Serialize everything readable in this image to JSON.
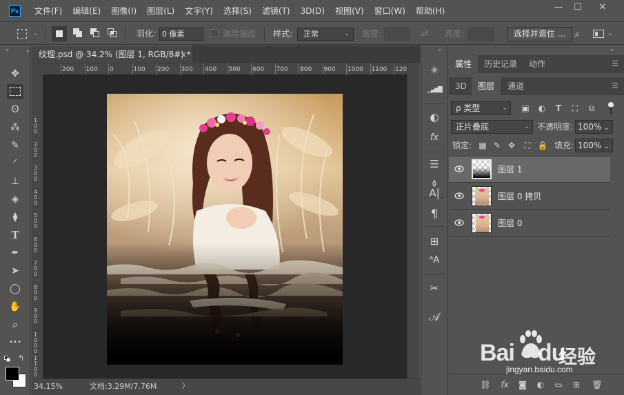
{
  "app": {
    "logo": "Ps"
  },
  "menu": [
    "文件(F)",
    "编辑(E)",
    "图像(I)",
    "图层(L)",
    "文字(Y)",
    "选择(S)",
    "滤镜(T)",
    "3D(D)",
    "视图(V)",
    "窗口(W)",
    "帮助(H)"
  ],
  "window_controls": {
    "minimize": "—",
    "restore": "☐",
    "close": "✕"
  },
  "options": {
    "feather_label": "羽化:",
    "feather_value": "0 像素",
    "antialias_label": "消除锯齿",
    "style_label": "样式:",
    "style_value": "正常",
    "width_label": "宽度:",
    "height_label": "高度:",
    "select_mask_button": "选择并遮住 ..."
  },
  "document": {
    "tab_title": "纹理.psd @ 34.2% (图层 1, RGB/8#) *",
    "close": "×",
    "ruler_h": [
      "200",
      "100",
      "0",
      "100",
      "200",
      "300",
      "400",
      "500",
      "600",
      "700",
      "800",
      "900",
      "1000",
      "1100",
      "1200"
    ],
    "ruler_v": [
      "1\n0\n0",
      "2\n0\n0",
      "3\n0\n0",
      "4\n0\n0",
      "5\n0\n0",
      "6\n0\n0",
      "7\n0\n0",
      "8\n0\n0",
      "9\n0\n0",
      "1\n0\n0\n0",
      "1\n1\n0\n0",
      "1\n2\n0\n0"
    ],
    "zoom": "34.15%",
    "doc_size": "文档:3.29M/7.76M",
    "status_arrow": "〉"
  },
  "tools": {
    "icons": [
      "move-icon",
      "marquee-icon",
      "lasso-icon",
      "magic-wand-icon",
      "eyedropper-icon",
      "brush-icon",
      "stamp-icon",
      "eraser-icon",
      "paint-bucket-icon",
      "type-icon",
      "pen-icon",
      "path-select-icon",
      "ellipse-icon",
      "hand-icon",
      "zoom-icon",
      "more-icon"
    ],
    "glyphs": [
      "✥",
      "⬚",
      "ʘ",
      "⁂",
      "✎",
      "ᐟ",
      "⊥",
      "◈",
      "⧫",
      "T",
      "✒",
      "➤",
      "◯",
      "✋",
      "⌕",
      "•••"
    ]
  },
  "strip": {
    "glyphs": [
      "✳",
      "▁▃▅▇",
      "◐",
      "fx",
      "☰",
      "⚱",
      "A|",
      "¶",
      "⊞",
      "ᴬA",
      "✂",
      "𝒜"
    ]
  },
  "panels": {
    "top_tabs": [
      "属性",
      "历史记录",
      "动作"
    ],
    "layer_tabs": [
      "3D",
      "图层",
      "通道"
    ],
    "filter_kind": "ρ 类型",
    "blend_mode": "正片叠底",
    "opacity_label": "不透明度:",
    "opacity_value": "100%",
    "lock_label": "锁定:",
    "fill_label": "填充:",
    "fill_value": "100%",
    "layers": [
      {
        "name": "图层 1",
        "selected": true
      },
      {
        "name": "图层 0 拷贝",
        "selected": false
      },
      {
        "name": "图层 0",
        "selected": false
      }
    ]
  },
  "watermark": {
    "brand": "Bai",
    "brand2": "du",
    "cn": "经验",
    "url": "jingyan.baidu.com"
  },
  "colors": {
    "ps_blue": "#31a8ff",
    "panel_bg": "#535353",
    "canvas_bg": "#282828",
    "selected_layer": "#696969"
  }
}
